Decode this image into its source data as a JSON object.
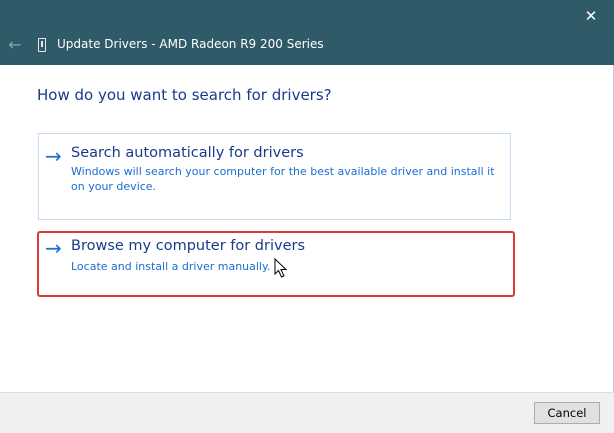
{
  "window": {
    "title": "Update Drivers - AMD Radeon R9 200 Series",
    "close_glyph": "✕",
    "back_glyph": "←"
  },
  "page": {
    "heading": "How do you want to search for drivers?"
  },
  "options": [
    {
      "arrow": "→",
      "title": "Search automatically for drivers",
      "description": "Windows will search your computer for the best available driver and install it on your device."
    },
    {
      "arrow": "→",
      "title": "Browse my computer for drivers",
      "description": "Locate and install a driver manually."
    }
  ],
  "footer": {
    "cancel_label": "Cancel"
  },
  "colors": {
    "titlebar": "#2f5a68",
    "heading": "#1a3a8c",
    "link": "#1a6fd0",
    "highlight_border": "#d93a3a"
  }
}
